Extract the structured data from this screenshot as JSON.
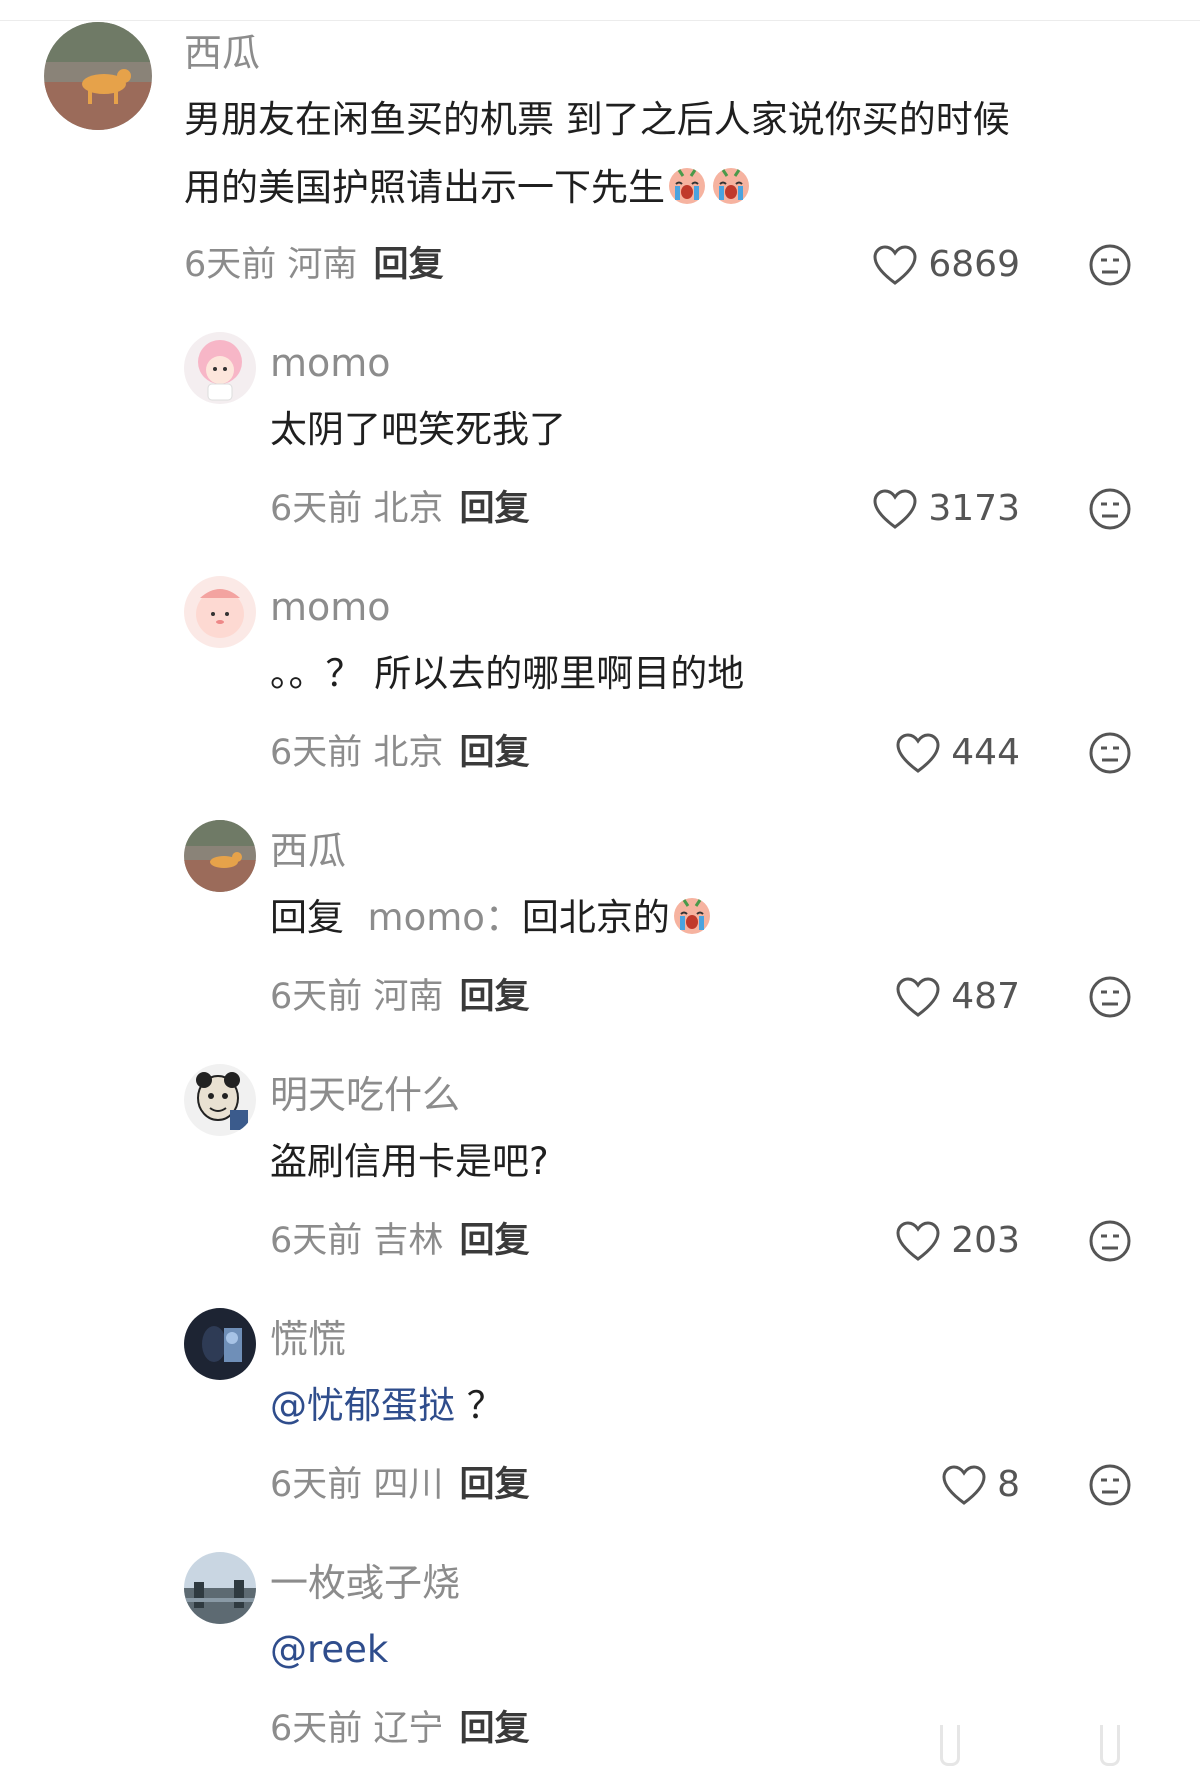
{
  "comments": [
    {
      "name": "西瓜",
      "text_line1": "男朋友在闲鱼买的机票 到了之后人家说你买的时候",
      "text_line2": "用的美国护照请出示一下先生",
      "time": "6天前",
      "location": "河南",
      "reply": "回复",
      "likes": "6869"
    },
    {
      "name": "momo",
      "text": "太阴了吧笑死我了",
      "time": "6天前",
      "location": "北京",
      "reply": "回复",
      "likes": "3173"
    },
    {
      "name": "momo",
      "text": "。。？ 所以去的哪里啊目的地",
      "time": "6天前",
      "location": "北京",
      "reply": "回复",
      "likes": "444"
    },
    {
      "name": "西瓜",
      "reply_prefix": "回复",
      "reply_to": "momo：",
      "text": "回北京的",
      "time": "6天前",
      "location": "河南",
      "reply": "回复",
      "likes": "487"
    },
    {
      "name": "明天吃什么",
      "text": "盗刷信用卡是吧?",
      "time": "6天前",
      "location": "吉林",
      "reply": "回复",
      "likes": "203"
    },
    {
      "name": "慌慌",
      "mention": "@忧郁蛋挞",
      "text": " ？",
      "time": "6天前",
      "location": "四川",
      "reply": "回复",
      "likes": "8"
    },
    {
      "name": "一枚彧子烧",
      "mention": "@reek",
      "time": "6天前",
      "location": "辽宁",
      "reply": "回复"
    }
  ],
  "icons": {
    "like": "heart-outline-icon",
    "dislike": "meh-face-icon",
    "cry_emoji": "crying-emoji"
  },
  "colors": {
    "text": "#1f1f1f",
    "muted": "#8c8c8c",
    "mention": "#2f4d8c"
  }
}
